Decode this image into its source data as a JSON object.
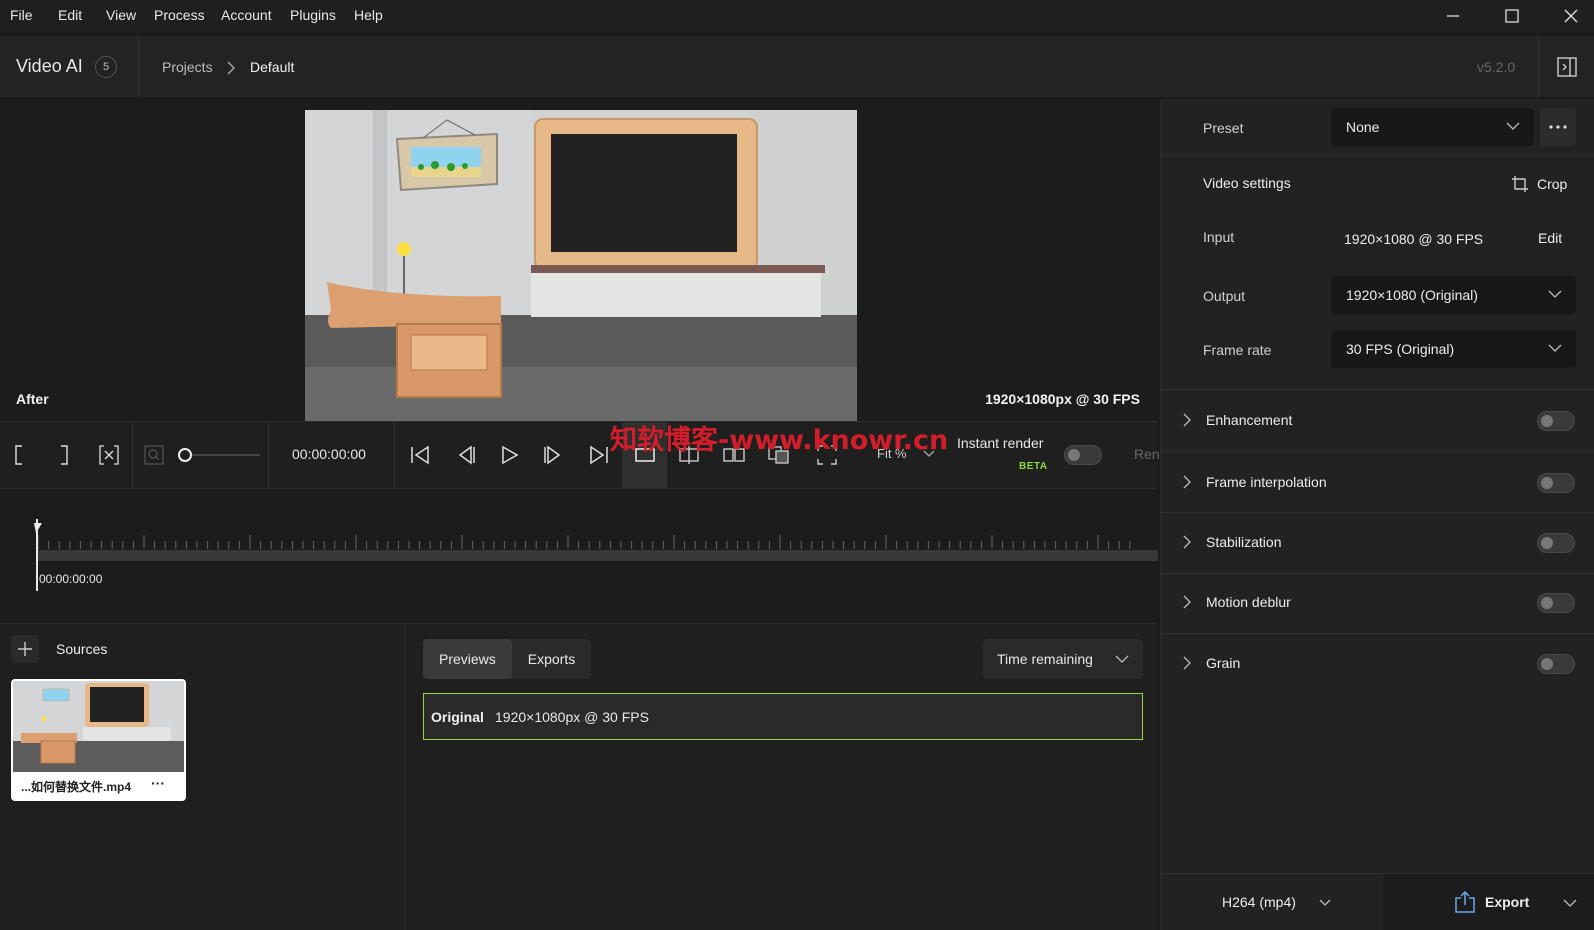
{
  "menubar": {
    "items": [
      "File",
      "Edit",
      "View",
      "Process",
      "Account",
      "Plugins",
      "Help"
    ]
  },
  "header": {
    "app_title": "Video AI",
    "app_badge": "5",
    "breadcrumb": [
      "Projects",
      "Default"
    ],
    "version": "v5.2.0"
  },
  "viewer": {
    "label": "After",
    "resolution": "1920×1080px @ 30 FPS"
  },
  "toolbar": {
    "timecode": "00:00:00:00",
    "zoom_label": "Fit %",
    "instant_render_label": "Instant render",
    "beta_label": "BETA",
    "render_label": "Ren"
  },
  "timeline": {
    "time": "00:00:00:00"
  },
  "sources": {
    "title": "Sources",
    "items": [
      {
        "name": "...如何替换文件.mp4",
        "more": "···"
      }
    ]
  },
  "exports": {
    "tabs": [
      "Previews",
      "Exports"
    ],
    "sort": "Time remaining",
    "rows": [
      {
        "name": "Original",
        "resolution": "1920×1080px @ 30 FPS"
      }
    ]
  },
  "right_panel": {
    "preset_label": "Preset",
    "preset_value": "None",
    "video_settings_label": "Video settings",
    "crop_label": "Crop",
    "input_label": "Input",
    "input_value": "1920×1080 @ 30 FPS",
    "edit_label": "Edit",
    "output_label": "Output",
    "output_value": "1920×1080 (Original)",
    "frame_rate_label": "Frame rate",
    "frame_rate_value": "30 FPS (Original)",
    "sections": [
      "Enhancement",
      "Frame interpolation",
      "Stabilization",
      "Motion deblur",
      "Grain"
    ],
    "codec": "H264 (mp4)",
    "export_label": "Export"
  },
  "watermark": "知软博客-www.knowr.cn",
  "colors": {
    "accent_green": "#9ad13a",
    "beta_green": "#8ed93a",
    "background": "#1c1c1c",
    "watermark_red": "#d21e2a"
  }
}
